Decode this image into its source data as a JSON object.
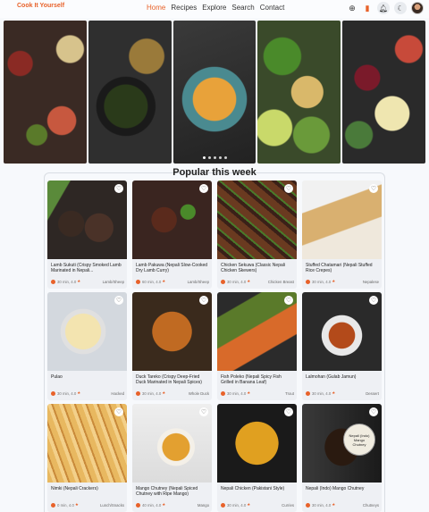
{
  "header": {
    "logo": "Cook It Yourself",
    "nav": [
      {
        "label": "Home",
        "active": true
      },
      {
        "label": "Recipes",
        "active": false
      },
      {
        "label": "Explore",
        "active": false
      },
      {
        "label": "Search",
        "active": false
      },
      {
        "label": "Contact",
        "active": false
      }
    ],
    "icons": [
      "add-circle-icon",
      "bookmark-icon",
      "bell-icon",
      "moon-icon",
      "user-avatar"
    ]
  },
  "hero": {
    "images": [
      "charcuterie-board",
      "bowl-salad",
      "soup-bowl",
      "vegetable-platter",
      "cheese-platter"
    ],
    "slides": 5,
    "active_slide": 1
  },
  "section": {
    "title": "Popular this week"
  },
  "recipes": [
    {
      "title": "Lamb Sukuti (Crispy Smoked Lamb Marinated in Nepali...",
      "time": "30 min, 4.0",
      "category": "Lamb/Sheep"
    },
    {
      "title": "Lamb Pakuwa (Nepali Slow-Cooked Dry Lamb Curry)",
      "time": "60 min, 4.0",
      "category": "Lamb/Sheep"
    },
    {
      "title": "Chicken Sekuwa (Classic Nepali Chicken Skewers)",
      "time": "30 min, 4.0",
      "category": "Chicken Breast"
    },
    {
      "title": "Stuffed Chatamari (Nepali Stuffed Rice Crepes)",
      "time": "30 min, 4.0",
      "category": "Nepalese"
    },
    {
      "title": "Pulao",
      "time": "30 min, 4.0",
      "category": "Hacked"
    },
    {
      "title": "Duck Tareko (Crispy Deep-Fried Duck Marinated in Nepali Spices)",
      "time": "30 min, 4.0",
      "category": "Whole Duck"
    },
    {
      "title": "Fish Poleko (Nepali Spicy Fish Grilled in Banana Leaf)",
      "time": "30 min, 4.0",
      "category": "Trout"
    },
    {
      "title": "Lalmohan (Gulab Jamun)",
      "time": "30 min, 4.0",
      "category": "Dessert"
    },
    {
      "title": "Nimki (Nepali Crackers)",
      "time": "0 min, 4.0",
      "category": "Lunch/Snacks"
    },
    {
      "title": "Mango Chutney (Nepali Spiced Chutney with Ripe Mango)",
      "time": "40 min, 4.0",
      "category": "Mango"
    },
    {
      "title": "Nepali Chicken (Pakistani Style)",
      "time": "30 min, 4.0",
      "category": "Curries"
    },
    {
      "title": "Nepali (Indo) Mango Chutney",
      "time": "30 min, 4.0",
      "category": "Chutneys"
    }
  ],
  "jar_label": "Nepali (Indo) Mango Chutney",
  "colors": {
    "accent": "#e8622a",
    "card_bg": "#eef0f4",
    "page_bg": "#f7f9fc"
  }
}
